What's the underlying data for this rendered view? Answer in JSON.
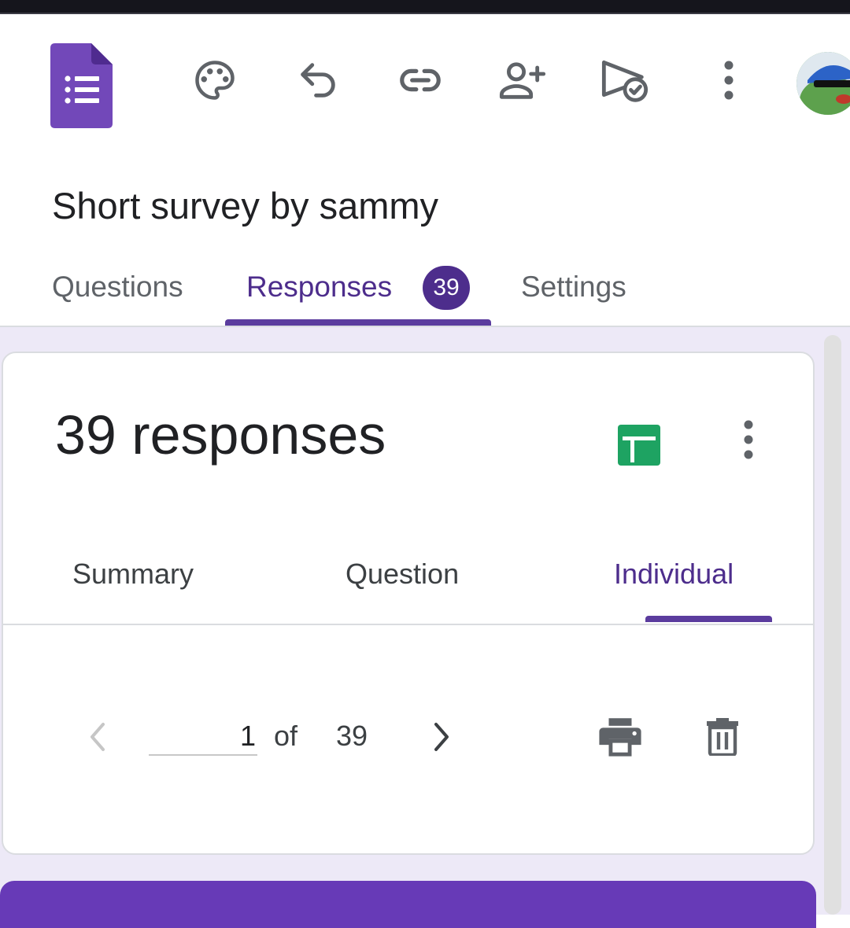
{
  "header": {
    "form_title": "Short survey by sammy",
    "toolbar_icons": [
      "palette-icon",
      "undo-icon",
      "link-icon",
      "add-collaborator-icon",
      "send-icon",
      "more-vert-icon"
    ],
    "avatar_icon": "profile-avatar"
  },
  "tabs": [
    {
      "label": "Questions",
      "active": false
    },
    {
      "label": "Responses",
      "active": true,
      "badge": "39"
    },
    {
      "label": "Settings",
      "active": false
    }
  ],
  "responses_card": {
    "title": "39 responses",
    "sheets_icon": "google-sheets-icon",
    "sub_tabs": [
      {
        "label": "Summary",
        "active": false
      },
      {
        "label": "Question",
        "active": false
      },
      {
        "label": "Individual",
        "active": true
      }
    ],
    "pager": {
      "current": "1",
      "of_label": "of",
      "total": "39"
    }
  },
  "colors": {
    "accent": "#4d2d8c",
    "brand_purple": "#673ab7",
    "sheets_green": "#1ea362",
    "background": "#ede9f7"
  }
}
